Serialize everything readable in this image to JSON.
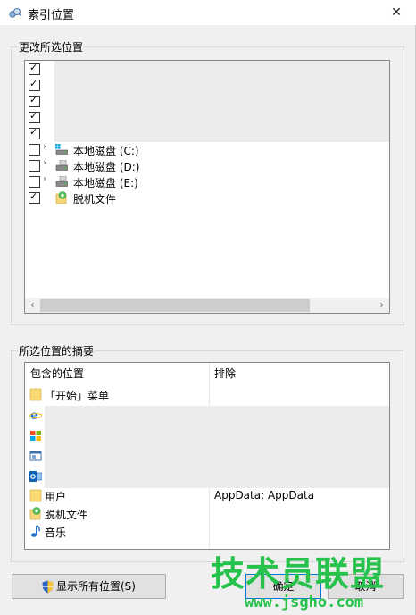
{
  "window": {
    "title": "索引位置",
    "close_glyph": "✕"
  },
  "change_group": {
    "title": "更改所选位置"
  },
  "tree": {
    "rows": [
      {
        "checked": true,
        "label": ""
      },
      {
        "checked": true,
        "label": ""
      },
      {
        "checked": true,
        "label": ""
      },
      {
        "checked": true,
        "label": ""
      },
      {
        "checked": true,
        "label": ""
      },
      {
        "checked": false,
        "label": "本地磁盘 (C:)",
        "icon": "windows-drive-icon"
      },
      {
        "checked": false,
        "label": "本地磁盘 (D:)",
        "icon": "drive-icon"
      },
      {
        "checked": false,
        "label": "本地磁盘 (E:)",
        "icon": "drive-icon"
      },
      {
        "checked": true,
        "label": "脱机文件",
        "icon": "offline-files-icon"
      }
    ],
    "check_glyph": "✓",
    "expand_glyph": "›",
    "scroll_left": "‹",
    "scroll_right": "›"
  },
  "summary_group": {
    "title": "所选位置的摘要"
  },
  "summary": {
    "col_included": "包含的位置",
    "col_excluded": "排除",
    "rows": [
      {
        "icon": "folder-icon",
        "label": "「开始」菜单",
        "exclude": ""
      },
      {
        "icon": "ie-icon",
        "label": "",
        "exclude": ""
      },
      {
        "icon": "windows-logo-icon",
        "label": "",
        "exclude": ""
      },
      {
        "icon": "window-app-icon",
        "label": "",
        "exclude": ""
      },
      {
        "icon": "outlook-icon",
        "label": "",
        "exclude": ""
      },
      {
        "icon": "folder-icon",
        "label": "用户",
        "exclude": "AppData; AppData"
      },
      {
        "icon": "offline-files-icon",
        "label": "脱机文件",
        "exclude": ""
      },
      {
        "icon": "music-icon",
        "label": "音乐",
        "exclude": ""
      }
    ]
  },
  "buttons": {
    "show_all": "显示所有位置(S)",
    "ok": "确定",
    "cancel": "取消"
  },
  "watermark": {
    "main": "技术员联盟",
    "sub": "www.jsgho.com"
  },
  "colors": {
    "accent": "#27c24c",
    "border": "#828790"
  }
}
